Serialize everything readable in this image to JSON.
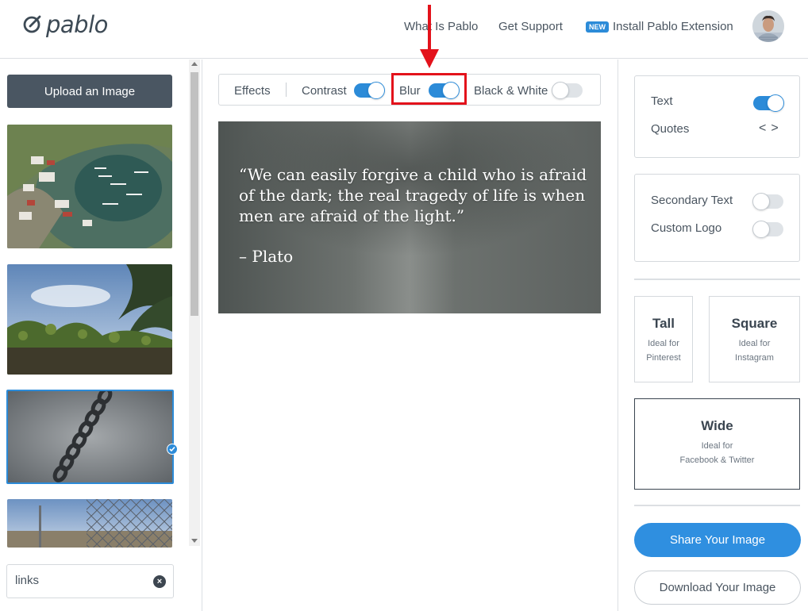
{
  "header": {
    "logo_text": "pablo",
    "nav": {
      "what": "What Is Pablo",
      "support": "Get Support",
      "install_badge": "NEW",
      "install": "Install Pablo Extension"
    }
  },
  "left": {
    "upload_label": "Upload an Image",
    "search_value": "links",
    "thumbnails": [
      {
        "subject": "aerial-marina",
        "selected": false
      },
      {
        "subject": "palm-sky-plants",
        "selected": false
      },
      {
        "subject": "chain-concrete",
        "selected": true
      },
      {
        "subject": "chainlink-fence",
        "selected": false
      }
    ]
  },
  "toolbar": {
    "effects": "Effects",
    "contrast": "Contrast",
    "contrast_on": true,
    "blur": "Blur",
    "blur_on": true,
    "bw": "Black & White",
    "bw_on": false
  },
  "canvas": {
    "quote": "“We can easily forgive a child who is afraid of the dark; the real tragedy of life is when men are afraid of the light.”",
    "author": "– Plato"
  },
  "right": {
    "text_label": "Text",
    "text_on": true,
    "quotes_label": "Quotes",
    "quotes_nav": "<>",
    "secondary_label": "Secondary Text",
    "secondary_on": false,
    "logo_label": "Custom Logo",
    "logo_on": false,
    "sizes": {
      "tall": {
        "title": "Tall",
        "line1": "Ideal for",
        "line2": "Pinterest"
      },
      "square": {
        "title": "Square",
        "line1": "Ideal for",
        "line2": "Instagram"
      },
      "wide": {
        "title": "Wide",
        "line1": "Ideal for",
        "line2": "Facebook & Twitter"
      }
    },
    "share_label": "Share Your Image",
    "download_label": "Download Your Image"
  },
  "colors": {
    "accent": "#2c8bd8",
    "highlight": "#e3121b",
    "upload_bg": "#4a5662"
  }
}
